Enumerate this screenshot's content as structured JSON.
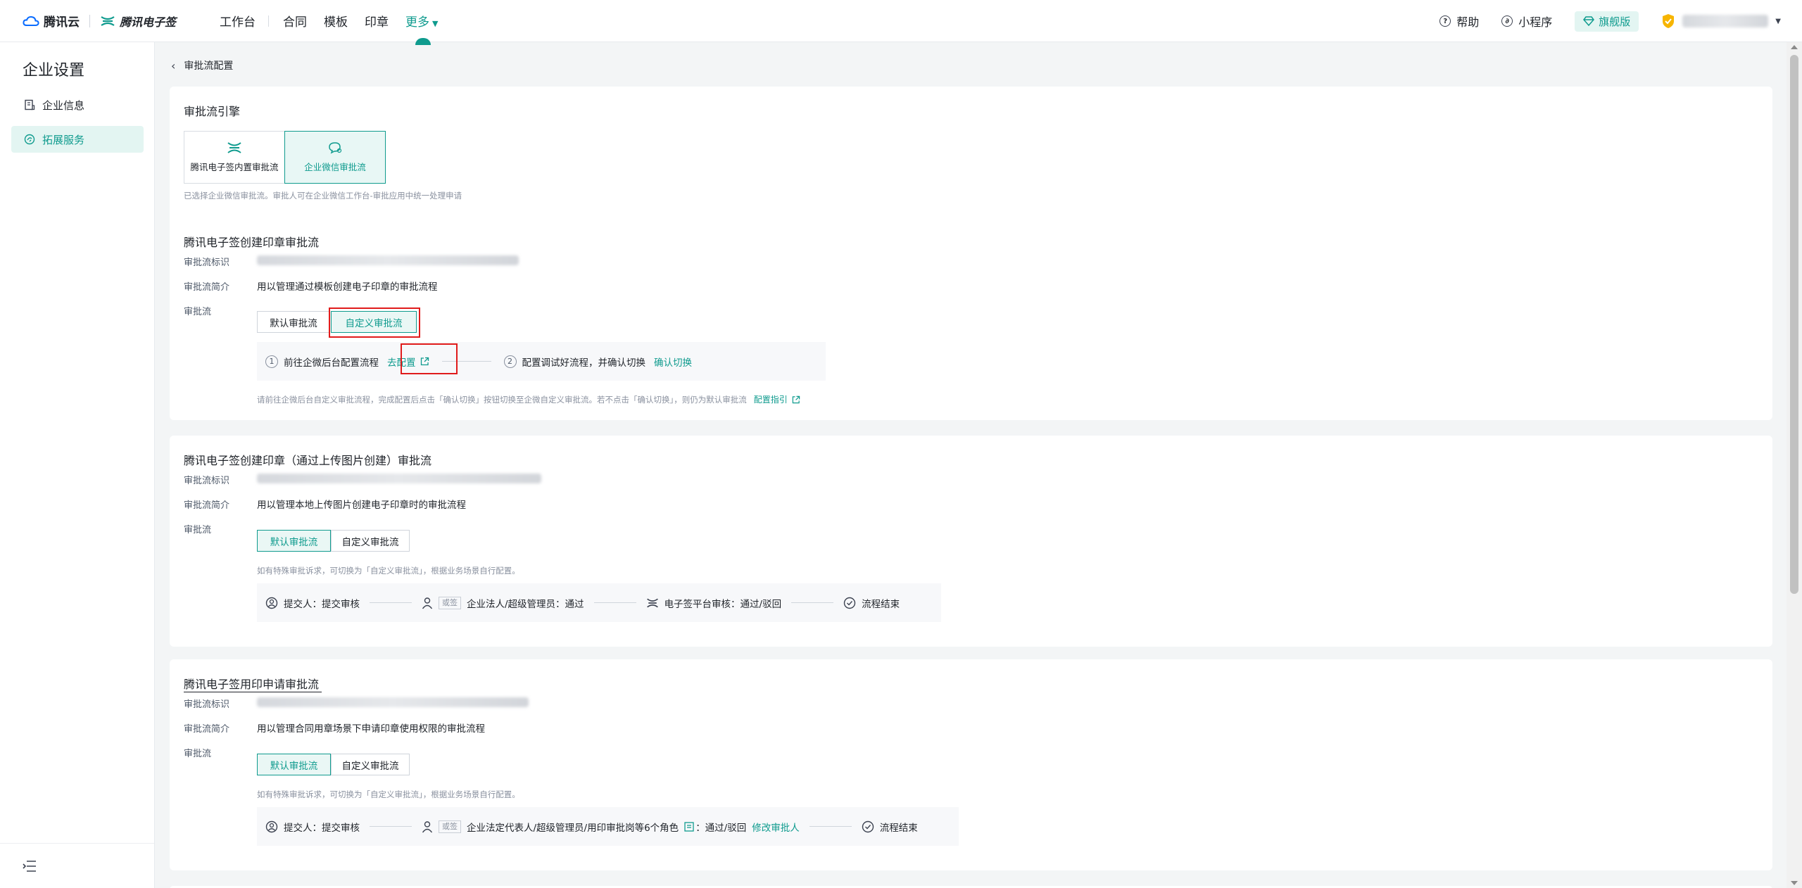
{
  "topbar": {
    "brand": "腾讯云",
    "product": "腾讯电子签",
    "nav": [
      "工作台",
      "合同",
      "模板",
      "印章",
      "更多"
    ],
    "help": "帮助",
    "mini_program": "小程序",
    "edition": "旗舰版"
  },
  "sidebar": {
    "title": "企业设置",
    "items": [
      {
        "label": "企业信息",
        "icon": "document-icon"
      },
      {
        "label": "拓展服务",
        "icon": "service-icon"
      }
    ]
  },
  "breadcrumb": {
    "title": "审批流配置"
  },
  "engine": {
    "title": "审批流引擎",
    "options": [
      "腾讯电子签内置审批流",
      "企业微信审批流"
    ],
    "selected": "企业微信审批流",
    "hint": "已选择企业微信审批流。审批人可在企业微信工作台-审批应用中统一处理申请"
  },
  "labels": {
    "id": "审批流标识",
    "desc": "审批流简介",
    "flow": "审批流",
    "default_flow": "默认审批流",
    "custom_flow": "自定义审批流",
    "default_hint": "如有特殊审批诉求，可切换为「自定义审批流」，根据业务场景自行配置。"
  },
  "card1": {
    "title": "腾讯电子签创建印章审批流",
    "desc": "用以管理通过模板创建电子印章的审批流程",
    "selected": "自定义审批流",
    "step1_num": "1",
    "step1": "前往企微后台配置流程",
    "step1_link": "去配置",
    "step2_num": "2",
    "step2": "配置调试好流程，并确认切换",
    "step2_link": "确认切换",
    "hint": "请前往企微后台自定义审批流程，完成配置后点击「确认切换」按钮切换至企微自定义审批流。若不点击「确认切换」，则仍为默认审批流",
    "hint_link": "配置指引"
  },
  "card2": {
    "title": "腾讯电子签创建印章（通过上传图片创建）审批流",
    "desc": "用以管理本地上传图片创建电子印章时的审批流程",
    "selected": "默认审批流",
    "flow": {
      "submit": "提交人：提交审核",
      "or_tag": "或签",
      "approver": "企业法人/超级管理员：通过",
      "platform": "电子签平台审核：通过/驳回",
      "end": "流程结束"
    }
  },
  "card3": {
    "title": "腾讯电子签用印申请审批流",
    "desc": "用以管理合同用章场景下申请印章使用权限的审批流程",
    "selected": "默认审批流",
    "flow": {
      "submit": "提交人：提交审核",
      "or_tag": "或签",
      "approver": "企业法定代表人/超级管理员/用印审批岗等6个角色",
      "result": "：通过/驳回",
      "modify_link": "修改审批人",
      "end": "流程结束"
    }
  },
  "colors": {
    "accent": "#0f9b8e",
    "highlight": "#e01b1b"
  }
}
